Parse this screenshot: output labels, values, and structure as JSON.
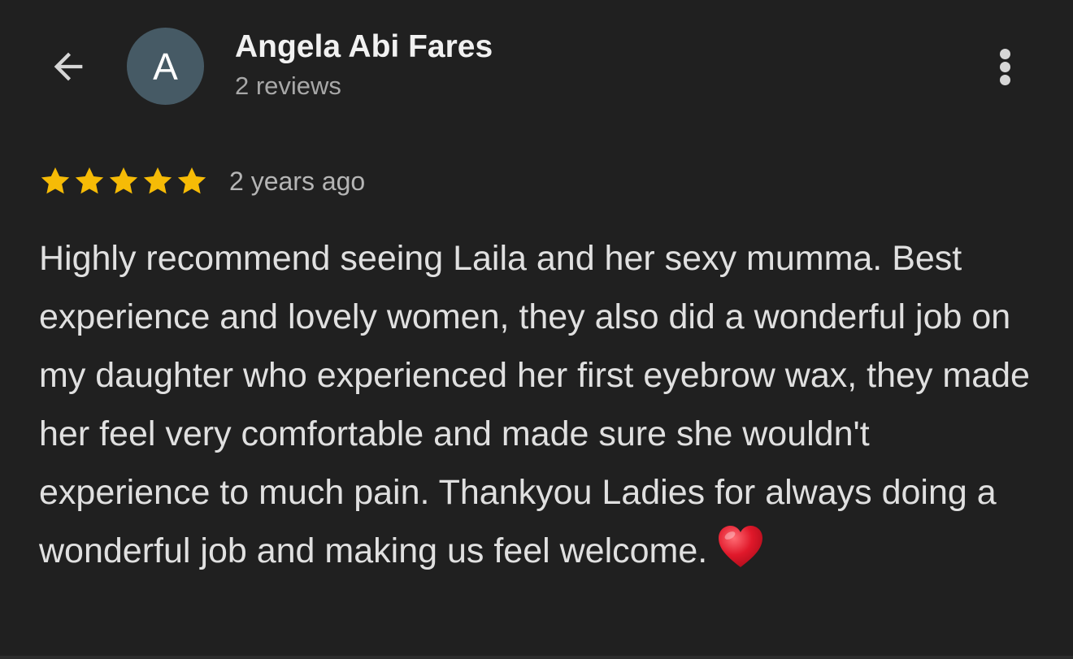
{
  "header": {
    "avatar_letter": "A",
    "reviewer_name": "Angela Abi Fares",
    "review_count": "2 reviews"
  },
  "review": {
    "rating": 5,
    "max_rating": 5,
    "time_ago": "2 years ago",
    "text": "Highly recommend seeing Laila and her sexy mumma. Best experience and lovely women, they also did a wonderful job on my daughter who experienced her first eyebrow wax, they made her feel very comfortable and made sure she wouldn't experience to much pain. Thankyou Ladies for always doing a wonderful job and making us feel welcome."
  },
  "icons": {
    "back": "arrow-left-icon",
    "more": "more-vert-icon",
    "star": "star-icon",
    "emoji": "red-heart-icon"
  },
  "colors": {
    "background": "#202020",
    "avatar_bg": "#465a65",
    "star": "#f6bb06",
    "heart": "#e0182a"
  }
}
